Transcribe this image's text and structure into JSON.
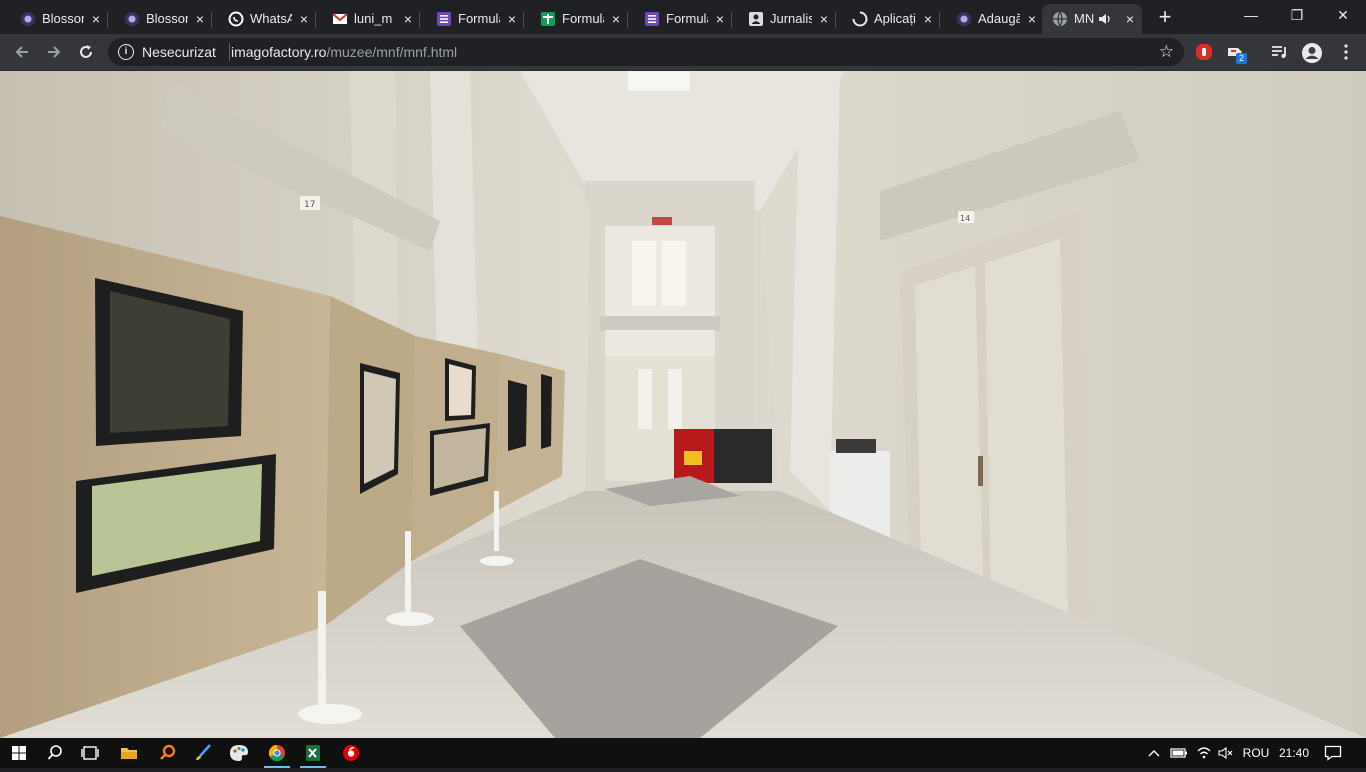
{
  "browser": {
    "tabs": [
      {
        "title": "Blossom",
        "icon": "blossom-icon",
        "active": false
      },
      {
        "title": "Blossom",
        "icon": "blossom-icon",
        "active": false
      },
      {
        "title": "WhatsApp",
        "icon": "whatsapp-icon",
        "active": false
      },
      {
        "title": "luni_m",
        "icon": "gmail-icon",
        "active": false
      },
      {
        "title": "Formular",
        "icon": "forms-icon",
        "active": false
      },
      {
        "title": "Formular",
        "icon": "sheets-icon",
        "active": false
      },
      {
        "title": "Formular",
        "icon": "forms-icon",
        "active": false
      },
      {
        "title": "Jurnalist",
        "icon": "contact-icon",
        "active": false
      },
      {
        "title": "Aplicații",
        "icon": "loading-icon",
        "active": false
      },
      {
        "title": "Adaugă",
        "icon": "blossom-icon",
        "active": false
      },
      {
        "title": "MNF",
        "icon": "globe-icon",
        "active": true,
        "audio": true
      }
    ],
    "close_glyph": "×",
    "new_tab_glyph": "+",
    "window": {
      "minimize": "—",
      "restore": "❐",
      "close": "✕"
    },
    "omnibox": {
      "security_label": "Nesecurizat",
      "host": "imagofactory.ro",
      "path": "/muzee/mnf/mnf.html"
    },
    "extensions": [
      {
        "icon": "stop-hand-icon",
        "badge": ""
      },
      {
        "icon": "cast-extension-icon",
        "badge": "2"
      },
      {
        "icon": "media-queue-icon",
        "badge": ""
      },
      {
        "icon": "profile-avatar-icon",
        "badge": ""
      },
      {
        "icon": "menu-dots-icon",
        "badge": ""
      }
    ]
  },
  "viewer": {
    "scene": "museum-hallway-panorama",
    "plaques": {
      "left_door": "17",
      "right_door": "14"
    }
  },
  "taskbar": {
    "apps": [
      "windows-start-icon",
      "search-icon",
      "task-view-icon",
      "file-explorer-icon",
      "search-tool-icon",
      "paint-brush-icon",
      "paint-palette-icon",
      "chrome-icon",
      "excel-icon",
      "vodafone-icon"
    ],
    "running": [
      "chrome-icon",
      "excel-icon"
    ],
    "tray": {
      "language": "ROU",
      "time": "21:40"
    }
  }
}
